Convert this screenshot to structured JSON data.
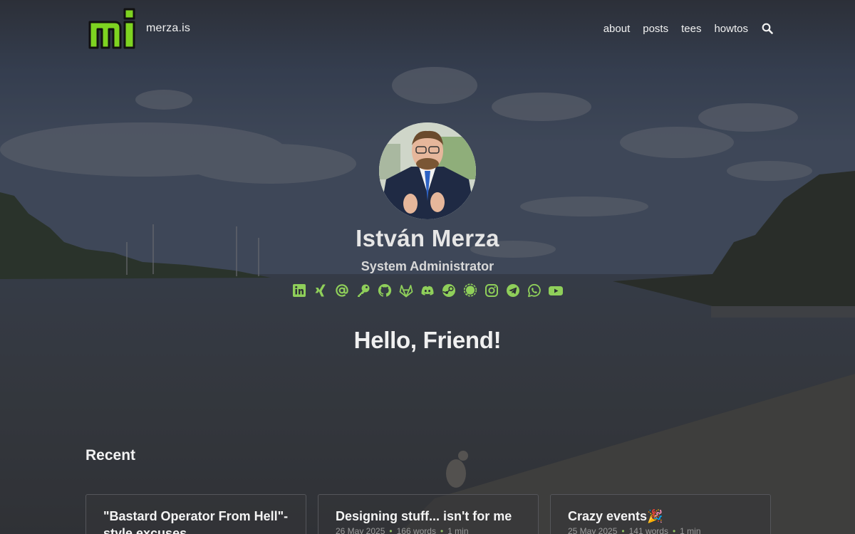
{
  "header": {
    "logo_text": "mi",
    "site_name": "merza.is",
    "nav": [
      "about",
      "posts",
      "tees",
      "howtos"
    ],
    "search_icon": "search-icon"
  },
  "profile": {
    "name": "István Merza",
    "title": "System Administrator",
    "social_icons": [
      "linkedin-icon",
      "xing-icon",
      "email-icon",
      "key-icon",
      "github-icon",
      "gitlab-icon",
      "discord-icon",
      "steam-icon",
      "signal-icon",
      "instagram-icon",
      "telegram-icon",
      "whatsapp-icon",
      "youtube-icon"
    ],
    "greeting": "Hello, Friend!"
  },
  "recent": {
    "heading": "Recent",
    "posts": [
      {
        "title": "\"Bastard Operator From Hell\"-style excuses",
        "meta": ""
      },
      {
        "title": "Designing stuff... isn't for me",
        "date": "26 May 2025",
        "words": "166 words",
        "read": "1 min"
      },
      {
        "title": "Crazy events🎉",
        "date": "25 May 2025",
        "words": "141 words",
        "read": "1 min"
      }
    ]
  },
  "colors": {
    "accent": "#8fcf5a",
    "logo_green": "#7ed321",
    "text": "#eaeaea",
    "card_border": "#55565b"
  }
}
